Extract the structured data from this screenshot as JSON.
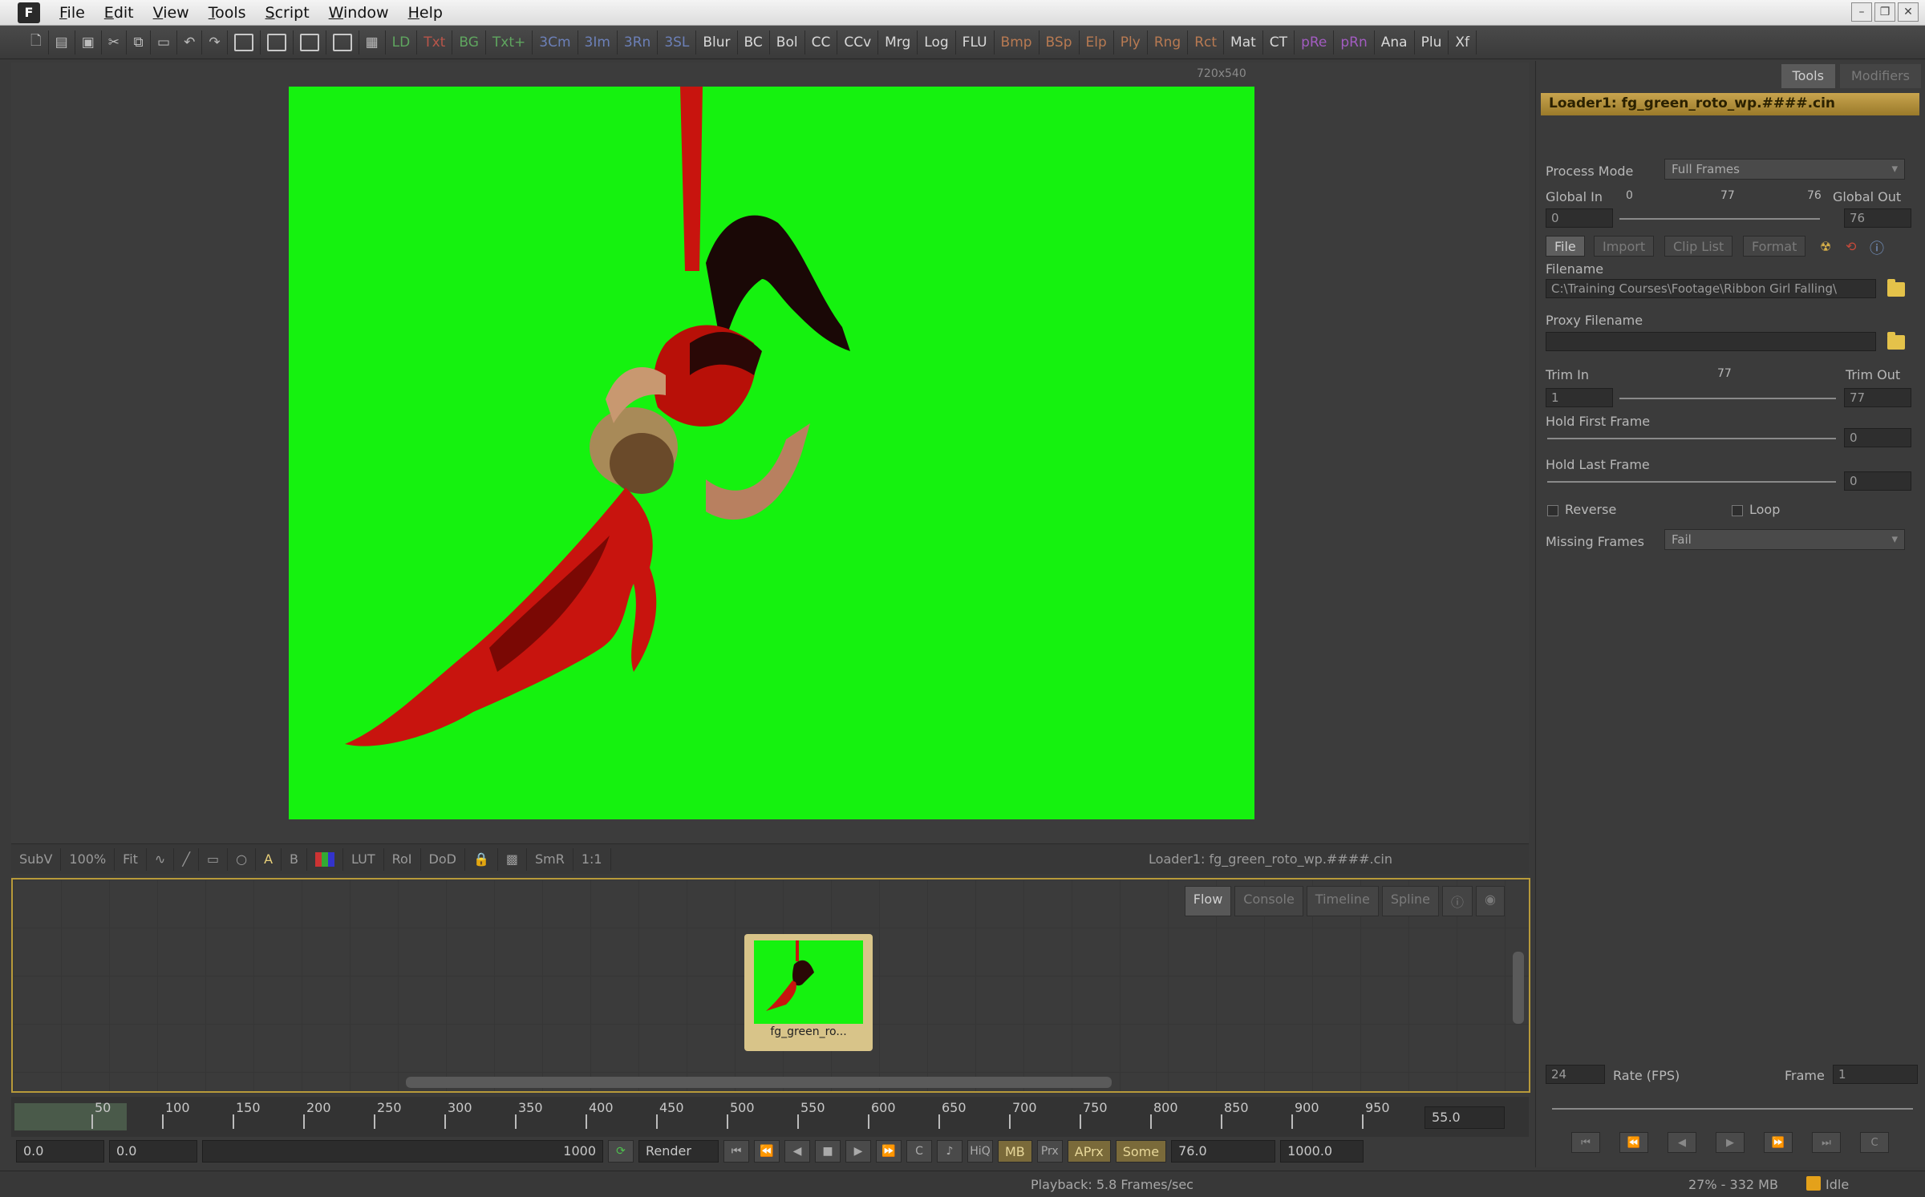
{
  "menubar": {
    "items": [
      "File",
      "Edit",
      "View",
      "Tools",
      "Script",
      "Window",
      "Help"
    ]
  },
  "toolbar": {
    "tools": [
      "LD",
      "Txt",
      "BG",
      "Txt+",
      "3Cm",
      "3Im",
      "3Rn",
      "3SL",
      "Blur",
      "BC",
      "Bol",
      "CC",
      "CCv",
      "Mrg",
      "Log",
      "FLU",
      "Bmp",
      "BSp",
      "Elp",
      "Ply",
      "Rng",
      "Rct",
      "Mat",
      "CT",
      "pRe",
      "pRn",
      "Ana",
      "Plu",
      "Xf"
    ]
  },
  "viewer": {
    "resolution": "720x540",
    "bottom_tools": [
      "SubV",
      "100%",
      "Fit",
      "LUT",
      "RoI",
      "DoD",
      "SmR",
      "1:1"
    ],
    "status": "Loader1: fg_green_roto_wp.####.cin"
  },
  "flow": {
    "tabs": [
      "Flow",
      "Console",
      "Timeline",
      "Spline"
    ],
    "node_label": "fg_green_ro..."
  },
  "timeline": {
    "ticks": [
      "50",
      "100",
      "150",
      "200",
      "250",
      "300",
      "350",
      "400",
      "450",
      "500",
      "550",
      "600",
      "650",
      "700",
      "750",
      "800",
      "850",
      "900",
      "950"
    ],
    "current_frame": "55.0",
    "render_start": "0.0",
    "global_start": "0.0",
    "global_end": "1000",
    "render_label": "Render",
    "hq_label": "HiQ",
    "mb_label": "MB",
    "prx_label": "Prx",
    "aprx_label": "APrx",
    "some_label": "Some",
    "render_end": "76.0",
    "global_end2": "1000.0"
  },
  "statusbar": {
    "playback": "Playback: 5.8 Frames/sec",
    "memory": "27% - 332 MB",
    "state": "Idle"
  },
  "inspector": {
    "tabs": [
      "Tools",
      "Modifiers"
    ],
    "title": "Loader1: fg_green_roto_wp.####.cin",
    "process_mode_label": "Process Mode",
    "process_mode_value": "Full Frames",
    "global_in_label": "Global In",
    "global_in_min": "0",
    "global_mid": "77",
    "global_in_max": "76",
    "global_out_label": "Global Out",
    "global_in_value": "0",
    "global_out_value": "76",
    "subtabs": [
      "File",
      "Import",
      "Clip List",
      "Format"
    ],
    "filename_label": "Filename",
    "filename_value": "C:\\Training Courses\\Footage\\Ribbon Girl Falling\\",
    "proxy_label": "Proxy Filename",
    "trim_in_label": "Trim In",
    "trim_mid": "77",
    "trim_out_label": "Trim Out",
    "trim_in_value": "1",
    "trim_out_value": "77",
    "hold_first_label": "Hold First Frame",
    "hold_first_value": "0",
    "hold_last_label": "Hold Last Frame",
    "hold_last_value": "0",
    "reverse_label": "Reverse",
    "loop_label": "Loop",
    "missing_label": "Missing Frames",
    "missing_value": "Fail",
    "fps_value": "24",
    "fps_label": "Rate (FPS)",
    "frame_label": "Frame",
    "frame_value": "1"
  },
  "colors": {
    "greenscreen": "#15f20f",
    "accent": "#c8a44e",
    "fabric": "#c8140e"
  }
}
